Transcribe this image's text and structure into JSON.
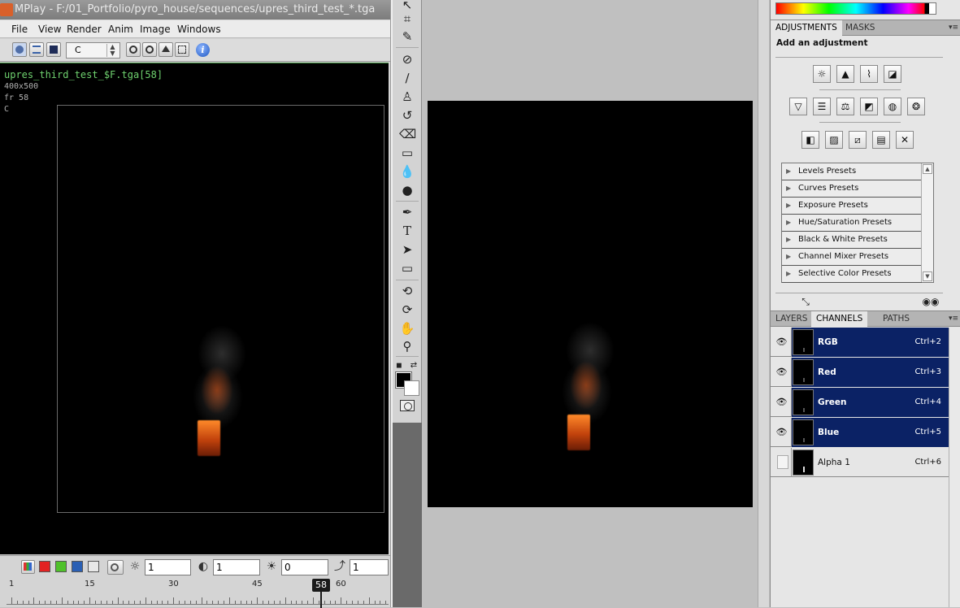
{
  "mplay": {
    "title": "MPlay - F:/01_Portfolio/pyro_house/sequences/upres_third_test_*.tga",
    "menu": [
      "File",
      "View",
      "Render",
      "Anim",
      "Image",
      "Windows"
    ],
    "channel_select": "C",
    "viewer": {
      "filename": "upres_third_test_$F.tga[58]",
      "resolution": "400x500",
      "frame_text": "fr 58",
      "channel_text": "C"
    },
    "bottom": {
      "gamma_value": "1",
      "contrast_value": "1",
      "offset_value": "0",
      "step_value": "1"
    },
    "timeline": {
      "labels": [
        "1",
        "15",
        "30",
        "45",
        "60"
      ],
      "current_frame": "58"
    }
  },
  "photoshop": {
    "tools": [
      "move-icon",
      "crop-icon",
      "eyedropper-icon",
      "healing-brush-icon",
      "brush-icon",
      "clone-stamp-icon",
      "history-brush-icon",
      "eraser-icon",
      "gradient-icon",
      "blur-icon",
      "dodge-icon",
      "pen-icon",
      "type-icon",
      "path-select-icon",
      "rectangle-icon",
      "3d-rotate-icon",
      "3d-orbit-icon",
      "hand-icon",
      "zoom-icon"
    ],
    "type_tool_label": "T",
    "adjustments_panel": {
      "tabs": [
        "ADJUSTMENTS",
        "MASKS"
      ],
      "title": "Add an adjustment",
      "presets": [
        "Levels Presets",
        "Curves Presets",
        "Exposure Presets",
        "Hue/Saturation Presets",
        "Black & White Presets",
        "Channel Mixer Presets",
        "Selective Color Presets"
      ]
    },
    "channels_panel": {
      "tabs": [
        "LAYERS",
        "CHANNELS",
        "PATHS"
      ],
      "channels": [
        {
          "name": "RGB",
          "shortcut": "Ctrl+2",
          "selected": true
        },
        {
          "name": "Red",
          "shortcut": "Ctrl+3",
          "selected": true
        },
        {
          "name": "Green",
          "shortcut": "Ctrl+4",
          "selected": true
        },
        {
          "name": "Blue",
          "shortcut": "Ctrl+5",
          "selected": true
        },
        {
          "name": "Alpha 1",
          "shortcut": "Ctrl+6",
          "selected": false
        }
      ]
    },
    "colors": {
      "selection": "#0b2265",
      "canvas": "#000000",
      "flame": "#e06a1e"
    }
  }
}
